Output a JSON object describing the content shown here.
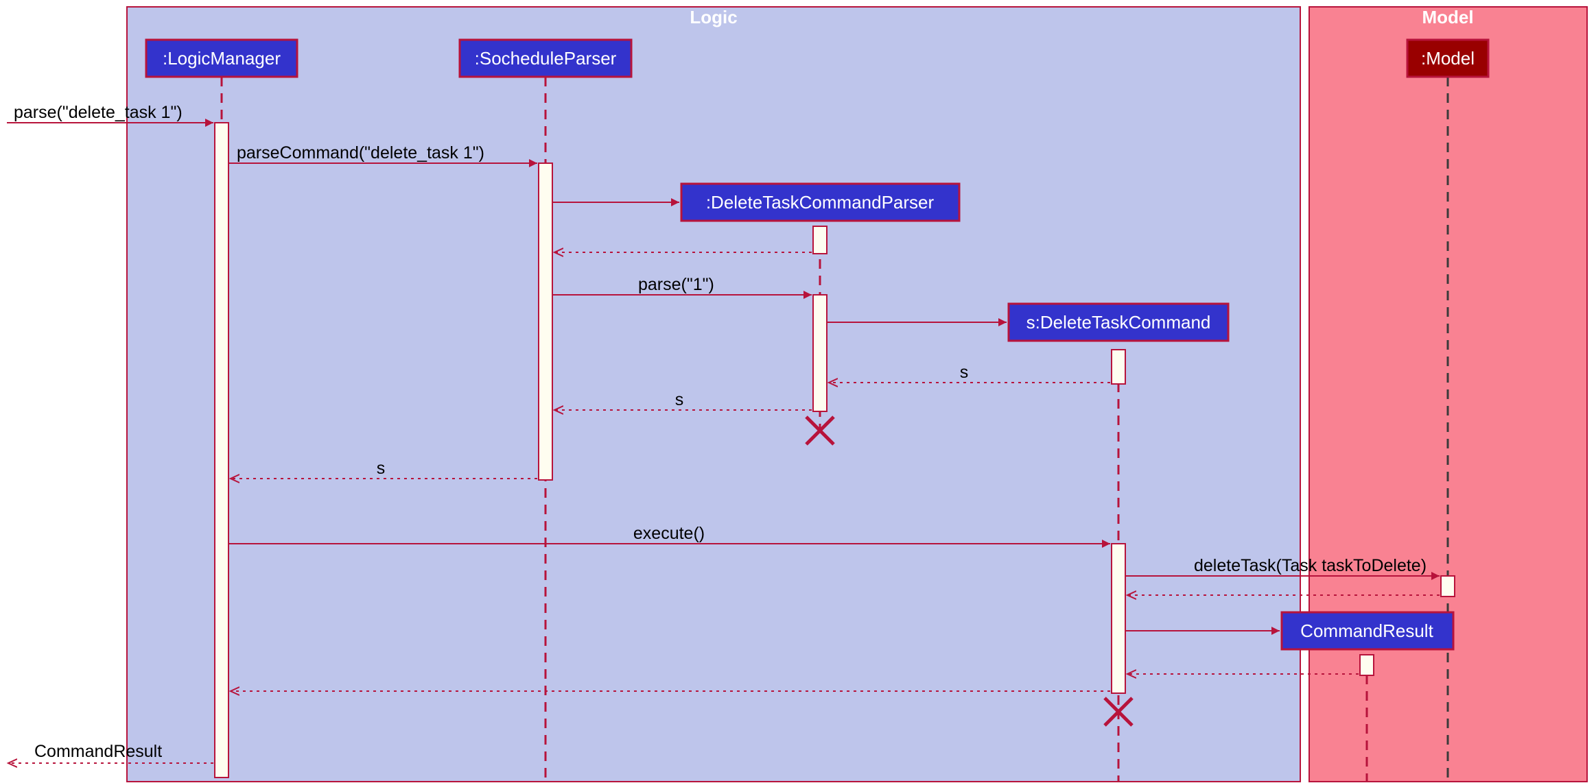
{
  "frames": {
    "logic": {
      "title": "Logic"
    },
    "model": {
      "title": "Model"
    }
  },
  "participants": {
    "logicManager": ":LogicManager",
    "socheduleParser": ":SocheduleParser",
    "deleteTaskCommandParser": ":DeleteTaskCommandParser",
    "deleteTaskCommand": "s:DeleteTaskCommand",
    "commandResult": "CommandResult",
    "model": ":Model"
  },
  "messages": {
    "parse_start": "parse(\"delete_task 1\")",
    "parseCommand": "parseCommand(\"delete_task 1\")",
    "parse1": "parse(\"1\")",
    "return_s1": "s",
    "return_s2": "s",
    "return_s3": "s",
    "execute": "execute()",
    "deleteTask": "deleteTask(Task taskToDelete)",
    "commandResult_return": "CommandResult"
  }
}
